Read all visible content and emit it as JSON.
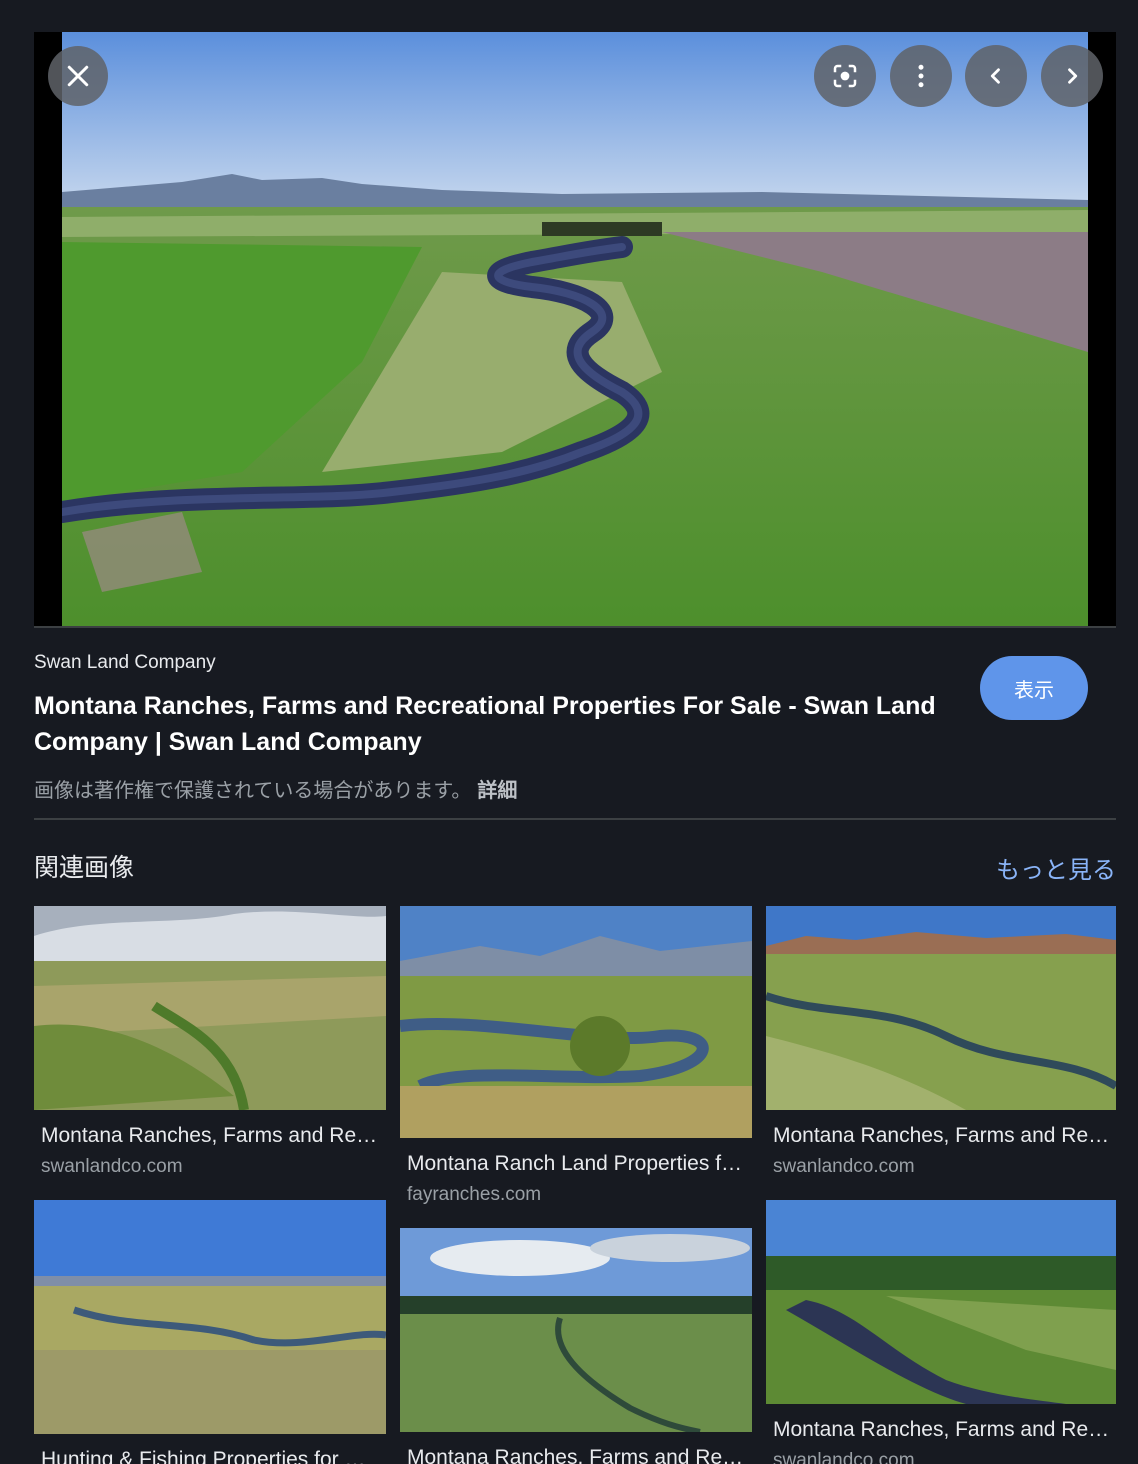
{
  "viewer": {
    "close_icon": "close-icon",
    "lens_icon": "lens-icon",
    "more_icon": "more-vert-icon",
    "prev_icon": "chevron-left-icon",
    "next_icon": "chevron-right-icon"
  },
  "result": {
    "source": "Swan Land Company",
    "title": "Montana Ranches, Farms and Recreational Properties For Sale - Swan Land Company | Swan Land Company",
    "copyright_notice": "画像は著作権で保護されている場合があります。",
    "detail_link": "詳細",
    "view_button": "表示"
  },
  "related": {
    "heading": "関連画像",
    "more_link": "もっと見る",
    "items": [
      {
        "title": "Montana Ranches, Farms and Recreational Properties For Sale - Swan Land Company",
        "site": "swanlandco.com"
      },
      {
        "title": "Montana Ranch Land Properties for Sale",
        "site": "fayranches.com"
      },
      {
        "title": "Montana Ranches, Farms and Recreational Properties For Sale - Swan Land Company",
        "site": "swanlandco.com"
      },
      {
        "title": "Hunting & Fishing Properties for Sale",
        "site": ""
      },
      {
        "title": "Montana Ranches, Farms and Recreational Properties For Sale - Swan Land Company",
        "site": ""
      },
      {
        "title": "Montana Ranches, Farms and Recreational Properties For Sale - Swan Land Company",
        "site": "swanlandco.com"
      }
    ]
  },
  "colors": {
    "background": "#171a21",
    "accent_button": "#5f95ea",
    "link": "#8ab4f8"
  }
}
